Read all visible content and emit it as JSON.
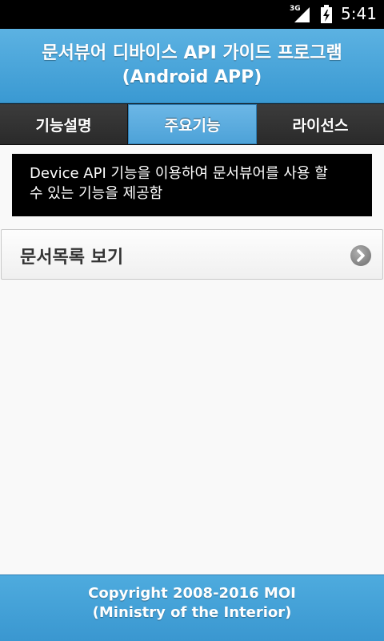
{
  "status_bar": {
    "network": "3G",
    "time": "5:41",
    "icons": [
      "signal-icon",
      "battery-charging-icon"
    ]
  },
  "header": {
    "title_line1": "문서뷰어 디바이스 API 가이드 프로그램",
    "title_line2": "(Android APP)"
  },
  "tabs": [
    {
      "label": "기능설명",
      "active": false
    },
    {
      "label": "주요기능",
      "active": true
    },
    {
      "label": "라이선스",
      "active": false
    }
  ],
  "description": {
    "line1": "Device API 기능을 이용하여 문서뷰어를 사용 할",
    "line2": "수 있는 기능을 제공함"
  },
  "list": {
    "items": [
      {
        "label": "문서목록 보기",
        "icon": "chevron-right-circle-icon"
      }
    ]
  },
  "footer": {
    "line1": "Copyright 2008-2016 MOI",
    "line2": "(Ministry of the Interior)"
  },
  "colors": {
    "header_blue": "#4da6da",
    "active_tab": "#5aace0",
    "inactive_tab": "#2f2f2f",
    "description_bg": "#000000",
    "footer_blue": "#3f9dd4"
  }
}
